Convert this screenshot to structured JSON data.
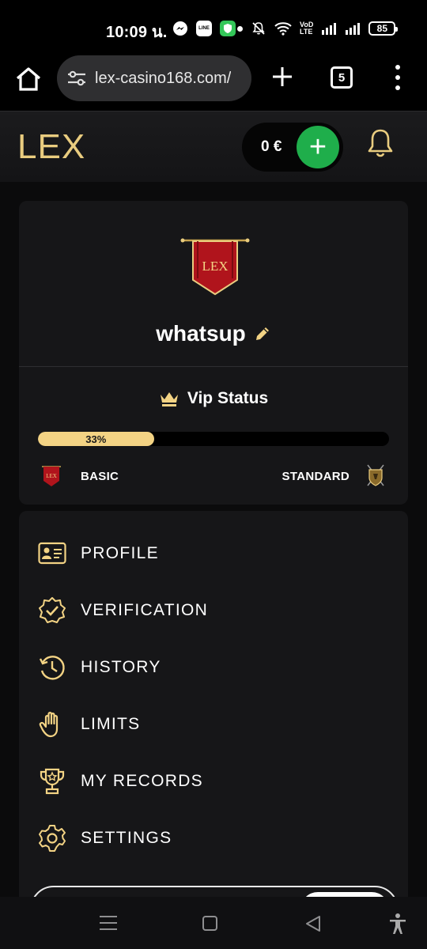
{
  "status_bar": {
    "time": "10:09 น.",
    "network_label_top": "VoD",
    "network_label_bottom": "LTE",
    "battery": "85"
  },
  "browser": {
    "url": "lex-casino168.com/",
    "tab_count": "5"
  },
  "site_header": {
    "logo": "LEX",
    "balance": "0 €",
    "deposit_symbol": "+"
  },
  "profile": {
    "banner_text": "LEX",
    "username": "whatsup",
    "vip_label": "Vip Status",
    "progress_percent": 33,
    "progress_label": "33%",
    "current_level": "BASIC",
    "next_level": "STANDARD",
    "mini_banner_text": "LEX"
  },
  "menu": {
    "items": [
      {
        "label": "PROFILE",
        "icon": "id-card-icon"
      },
      {
        "label": "VERIFICATION",
        "icon": "verified-badge-icon"
      },
      {
        "label": "HISTORY",
        "icon": "history-icon"
      },
      {
        "label": "LIMITS",
        "icon": "hand-icon"
      },
      {
        "label": "MY RECORDS",
        "icon": "trophy-icon"
      },
      {
        "label": "SETTINGS",
        "icon": "gear-icon"
      }
    ]
  },
  "colors": {
    "gold": "#e9cc7f",
    "progress_gold": "#f3d384",
    "deposit_green": "#1fae4b",
    "card_bg": "#161618",
    "banner_red": "#b0141c"
  }
}
